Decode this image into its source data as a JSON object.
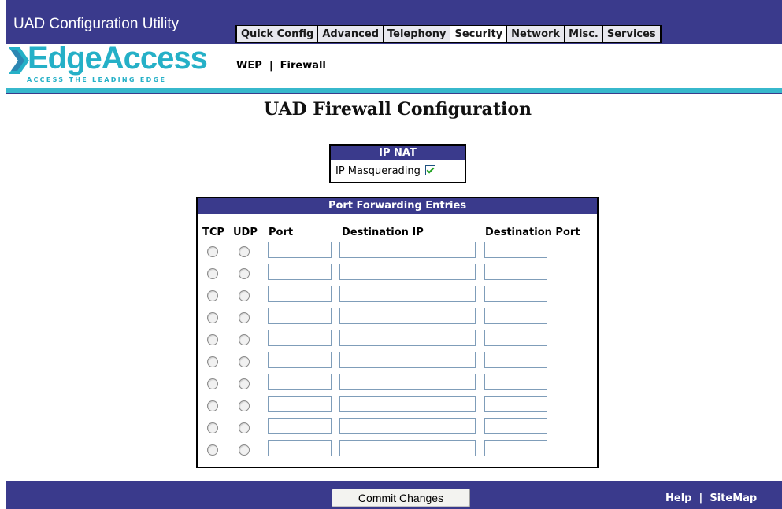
{
  "app": {
    "title": "UAD Configuration Utility"
  },
  "tabs": [
    {
      "label": "Quick Config"
    },
    {
      "label": "Advanced"
    },
    {
      "label": "Telephony"
    },
    {
      "label": "Security",
      "active": true
    },
    {
      "label": "Network"
    },
    {
      "label": "Misc."
    },
    {
      "label": "Services"
    }
  ],
  "logo": {
    "name": "EdgeAccess",
    "tagline": "ACCESS THE LEADING EDGE"
  },
  "subnav": {
    "wep": "WEP",
    "separator": "|",
    "firewall": "Firewall"
  },
  "page": {
    "title": "UAD Firewall Configuration"
  },
  "ip_nat": {
    "header": "IP NAT",
    "masquerading_label": "IP Masquerading",
    "masquerading_checked": true
  },
  "port_forwarding": {
    "header": "Port Forwarding Entries",
    "columns": {
      "tcp": "TCP",
      "udp": "UDP",
      "port": "Port",
      "dest_ip": "Destination IP",
      "dest_port": "Destination Port"
    },
    "rows": [
      {
        "tcp": false,
        "udp": false,
        "port": "",
        "dest_ip": "",
        "dest_port": ""
      },
      {
        "tcp": false,
        "udp": false,
        "port": "",
        "dest_ip": "",
        "dest_port": ""
      },
      {
        "tcp": false,
        "udp": false,
        "port": "",
        "dest_ip": "",
        "dest_port": ""
      },
      {
        "tcp": false,
        "udp": false,
        "port": "",
        "dest_ip": "",
        "dest_port": ""
      },
      {
        "tcp": false,
        "udp": false,
        "port": "",
        "dest_ip": "",
        "dest_port": ""
      },
      {
        "tcp": false,
        "udp": false,
        "port": "",
        "dest_ip": "",
        "dest_port": ""
      },
      {
        "tcp": false,
        "udp": false,
        "port": "",
        "dest_ip": "",
        "dest_port": ""
      },
      {
        "tcp": false,
        "udp": false,
        "port": "",
        "dest_ip": "",
        "dest_port": ""
      },
      {
        "tcp": false,
        "udp": false,
        "port": "",
        "dest_ip": "",
        "dest_port": ""
      },
      {
        "tcp": false,
        "udp": false,
        "port": "",
        "dest_ip": "",
        "dest_port": ""
      }
    ]
  },
  "footer": {
    "commit_label": "Commit Changes",
    "help": "Help",
    "separator": "|",
    "sitemap": "SiteMap"
  },
  "colors": {
    "band": "#3a3a8c",
    "teal": "#37b8cc",
    "logo": "#25b0c7",
    "check": "#21a121"
  }
}
